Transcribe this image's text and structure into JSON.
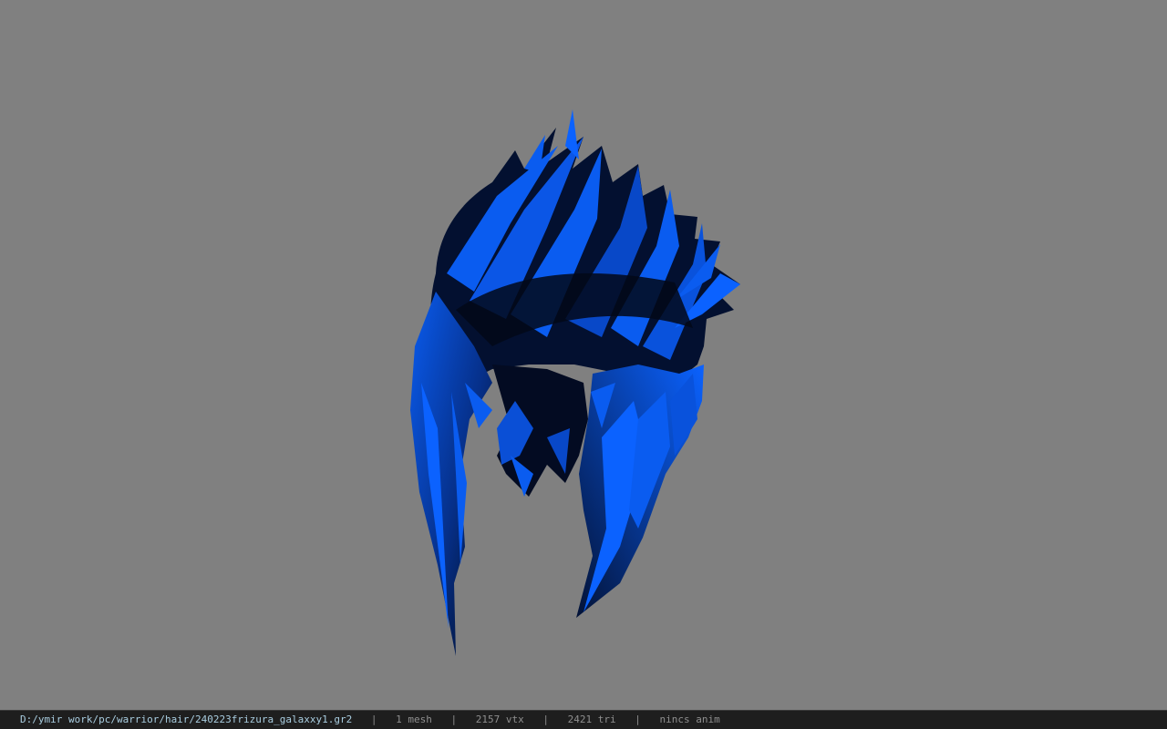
{
  "viewport": {
    "background": "#808080",
    "model": {
      "icon": "hair-mesh",
      "color_light": "#0a5cf0",
      "color_dark": "#020817"
    }
  },
  "statusbar": {
    "path": "D:/ymir work/pc/warrior/hair/240223frizura_galaxxy1.gr2",
    "separator": "|",
    "mesh_count": "1 mesh",
    "vertex_count": "2157 vtx",
    "triangle_count": "2421 tri",
    "anim": "nincs anim"
  }
}
